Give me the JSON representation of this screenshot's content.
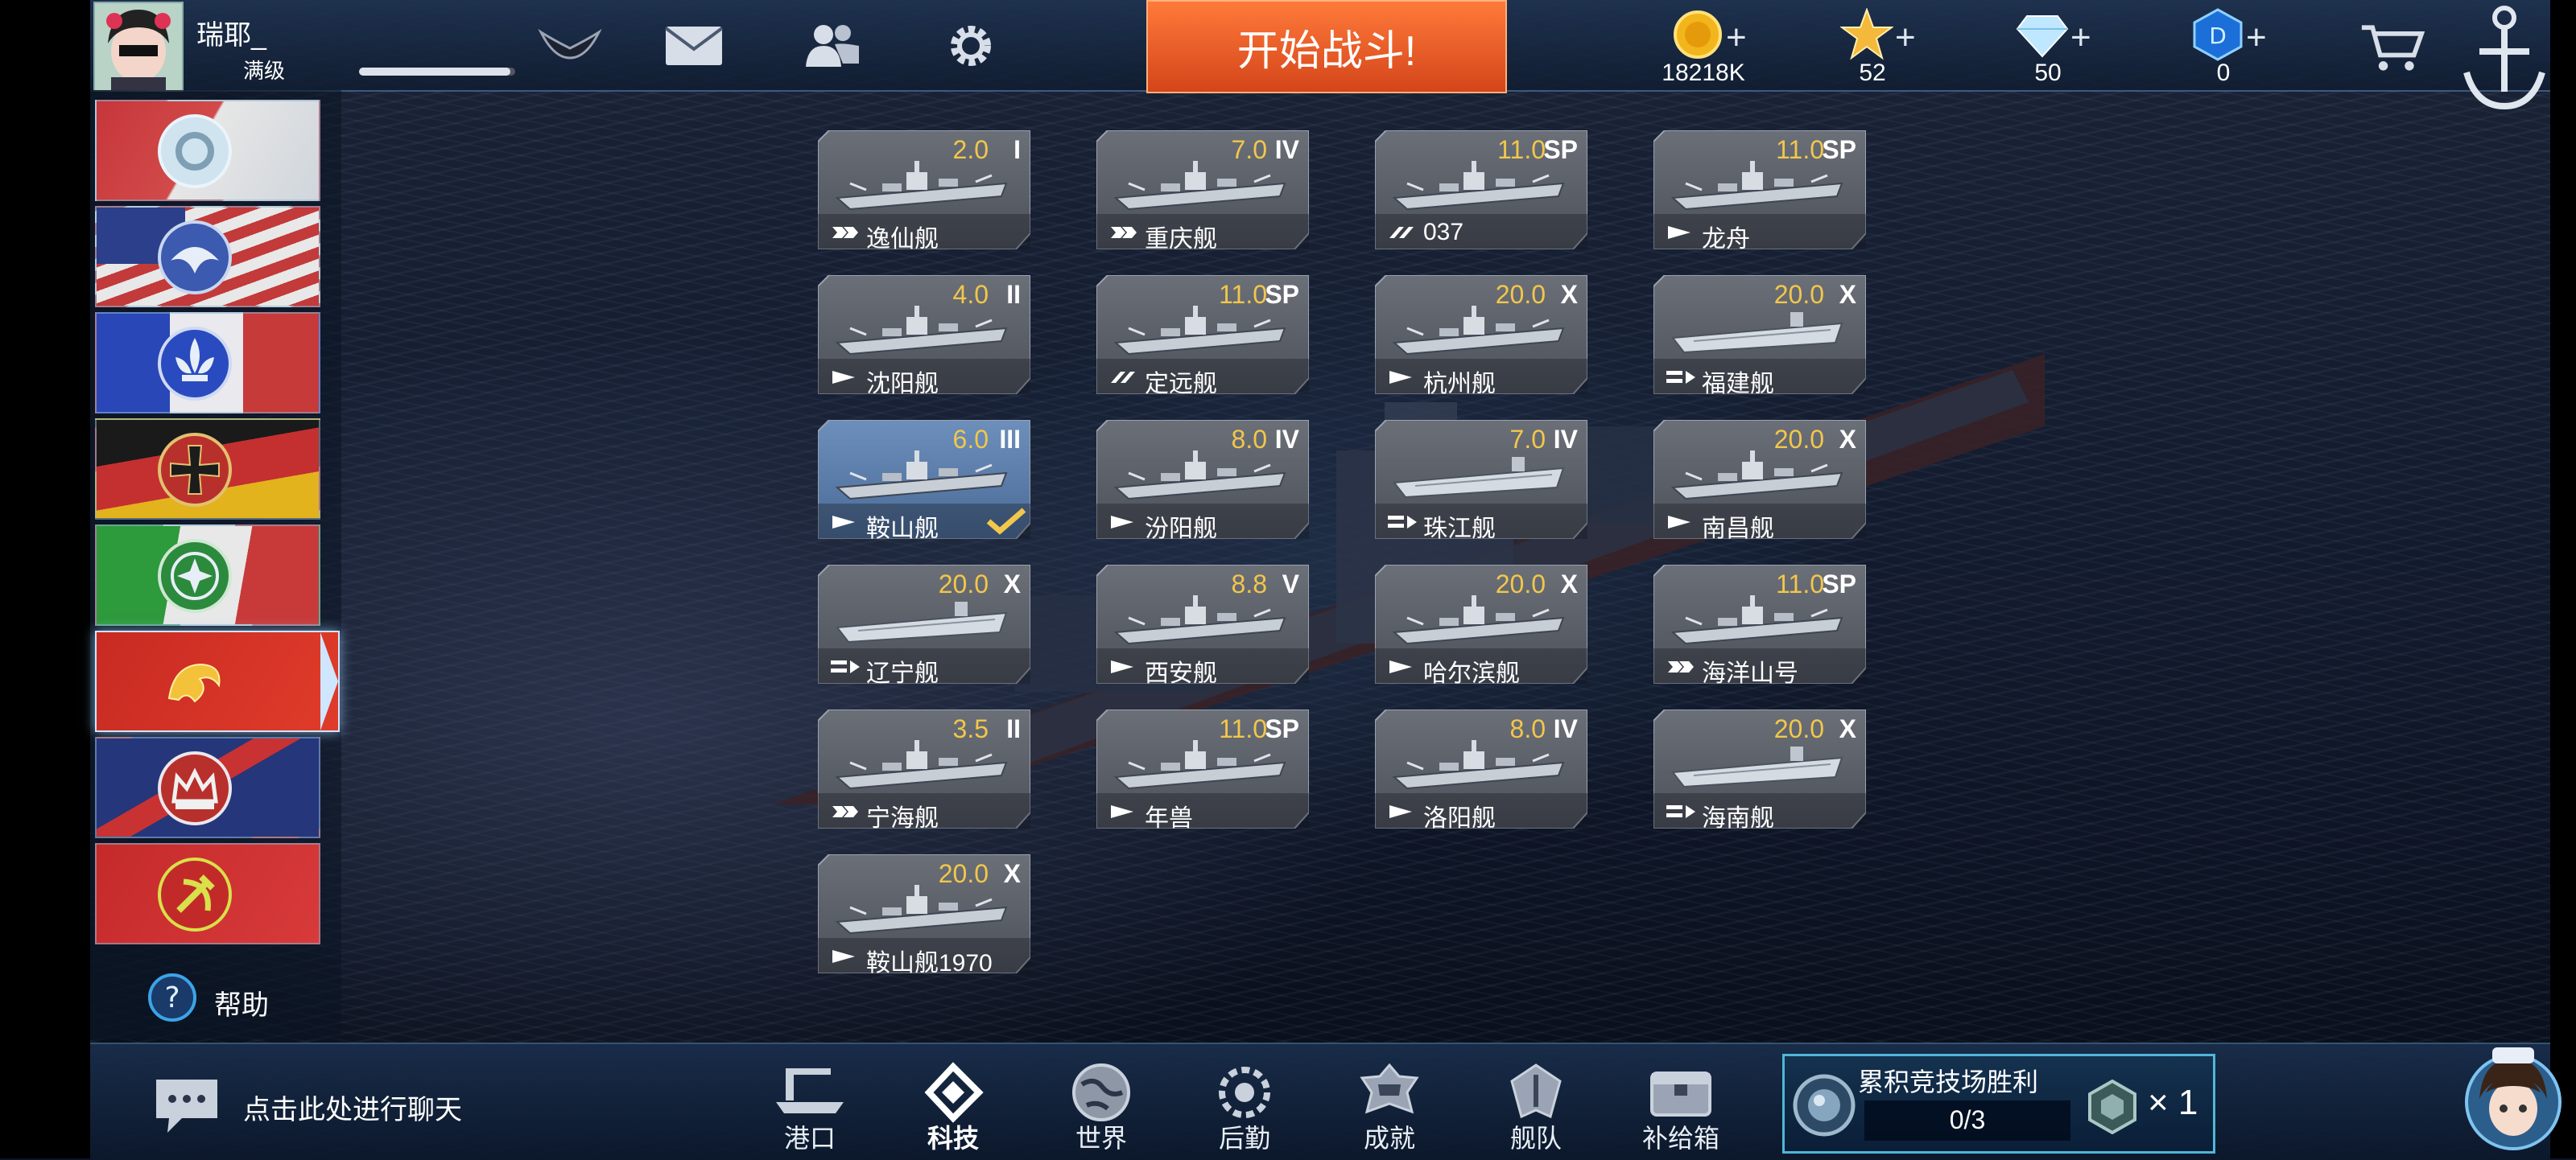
{
  "player": {
    "name": "瑞耶_",
    "level": "满级",
    "xp_fraction": 0.97
  },
  "topbar": {
    "start_battle": "开始战斗!"
  },
  "resources": [
    {
      "icon": "gold-coin-icon",
      "value": "18218K"
    },
    {
      "icon": "star-icon",
      "value": "52"
    },
    {
      "icon": "diamond-icon",
      "value": "50"
    },
    {
      "icon": "blue-gem-icon",
      "value": "0"
    }
  ],
  "nations": [
    "japan",
    "usa",
    "france",
    "germany",
    "italy",
    "china",
    "uk",
    "ussr"
  ],
  "active_nation": "china",
  "help_label": "帮助",
  "ships": [
    {
      "name": "逸仙舰",
      "stat": "2.0",
      "tier": "I",
      "type": "destroyer",
      "selected": false
    },
    {
      "name": "重庆舰",
      "stat": "7.0",
      "tier": "IV",
      "type": "destroyer",
      "selected": false
    },
    {
      "name": "037",
      "stat": "11.0",
      "tier": "SP",
      "type": "torpedo-boat",
      "selected": false
    },
    {
      "name": "龙舟",
      "stat": "11.0",
      "tier": "SP",
      "type": "light",
      "selected": false
    },
    {
      "name": "沈阳舰",
      "stat": "4.0",
      "tier": "II",
      "type": "light",
      "selected": false
    },
    {
      "name": "定远舰",
      "stat": "11.0",
      "tier": "SP",
      "type": "torpedo-boat",
      "selected": false
    },
    {
      "name": "杭州舰",
      "stat": "20.0",
      "tier": "X",
      "type": "light",
      "selected": false
    },
    {
      "name": "福建舰",
      "stat": "20.0",
      "tier": "X",
      "type": "carrier",
      "selected": false
    },
    {
      "name": "鞍山舰",
      "stat": "6.0",
      "tier": "III",
      "type": "light",
      "selected": true
    },
    {
      "name": "汾阳舰",
      "stat": "8.0",
      "tier": "IV",
      "type": "light",
      "selected": false
    },
    {
      "name": "珠江舰",
      "stat": "7.0",
      "tier": "IV",
      "type": "carrier",
      "selected": false
    },
    {
      "name": "南昌舰",
      "stat": "20.0",
      "tier": "X",
      "type": "light",
      "selected": false
    },
    {
      "name": "辽宁舰",
      "stat": "20.0",
      "tier": "X",
      "type": "carrier",
      "selected": false
    },
    {
      "name": "西安舰",
      "stat": "8.8",
      "tier": "V",
      "type": "light",
      "selected": false
    },
    {
      "name": "哈尔滨舰",
      "stat": "20.0",
      "tier": "X",
      "type": "light",
      "selected": false
    },
    {
      "name": "海洋山号",
      "stat": "11.0",
      "tier": "SP",
      "type": "destroyer",
      "selected": false
    },
    {
      "name": "宁海舰",
      "stat": "3.5",
      "tier": "II",
      "type": "destroyer",
      "selected": false
    },
    {
      "name": "年兽",
      "stat": "11.0",
      "tier": "SP",
      "type": "light",
      "selected": false
    },
    {
      "name": "洛阳舰",
      "stat": "8.0",
      "tier": "IV",
      "type": "light",
      "selected": false
    },
    {
      "name": "海南舰",
      "stat": "20.0",
      "tier": "X",
      "type": "carrier",
      "selected": false
    },
    {
      "name": "鞍山舰1970",
      "stat": "20.0",
      "tier": "X",
      "type": "light",
      "selected": false
    }
  ],
  "chat": {
    "placeholder": "点击此处进行聊天"
  },
  "nav": [
    {
      "label": "港口",
      "icon": "harbor-icon"
    },
    {
      "label": "科技",
      "icon": "tech-icon",
      "active": true
    },
    {
      "label": "世界",
      "icon": "globe-icon"
    },
    {
      "label": "后勤",
      "icon": "logistics-icon"
    },
    {
      "label": "成就",
      "icon": "achievement-icon"
    },
    {
      "label": "舰队",
      "icon": "fleet-icon"
    },
    {
      "label": "补给箱",
      "icon": "supply-box-icon"
    }
  ],
  "mission": {
    "title": "累积竞技场胜利",
    "progress": "0/3",
    "reward_count": "× 1"
  },
  "colors": {
    "accent_orange": "#e0531f",
    "stat_gold": "#f2c74a",
    "mission_border": "#4fb7d8"
  }
}
